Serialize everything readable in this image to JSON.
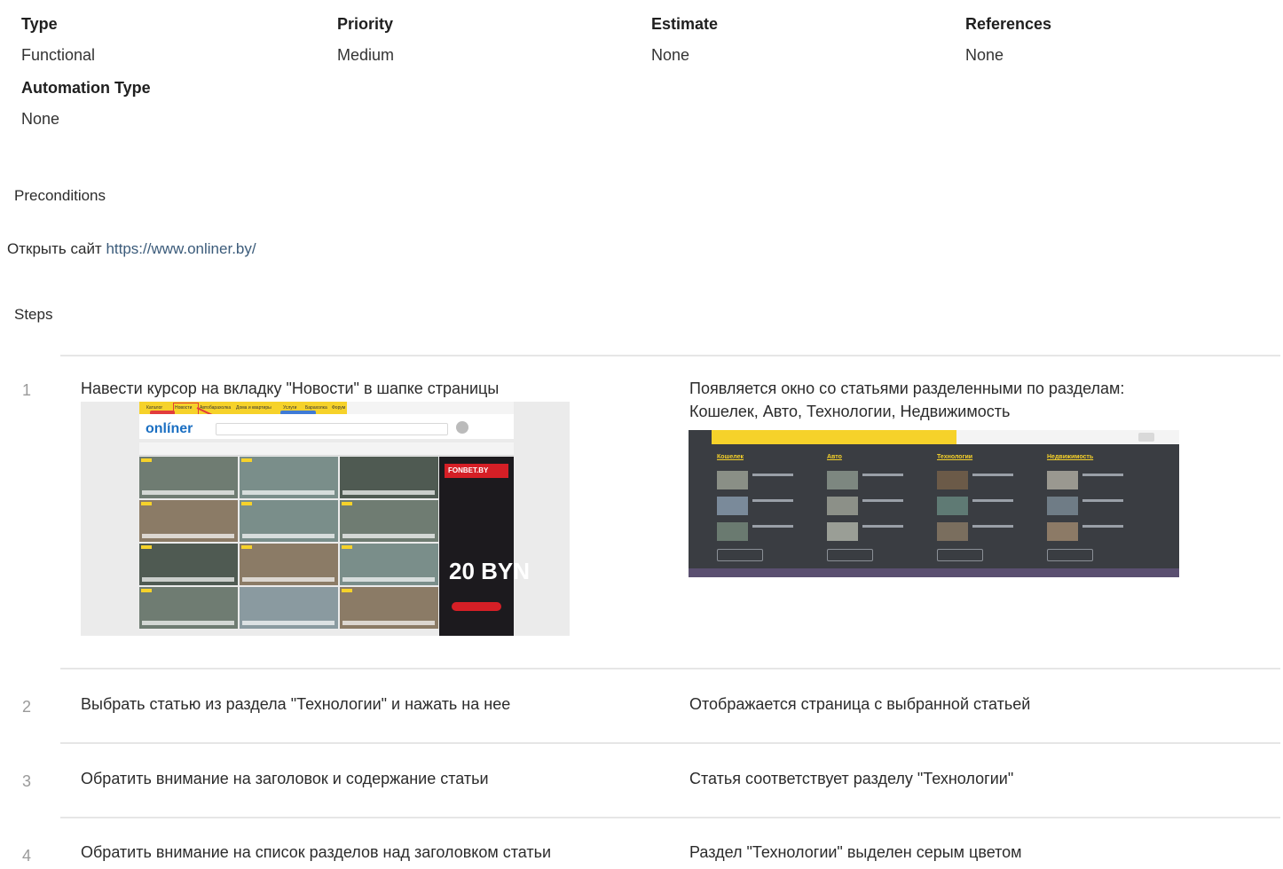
{
  "meta": {
    "type_label": "Type",
    "type_value": "Functional",
    "priority_label": "Priority",
    "priority_value": "Medium",
    "estimate_label": "Estimate",
    "estimate_value": "None",
    "references_label": "References",
    "references_value": "None",
    "automation_label": "Automation Type",
    "automation_value": "None"
  },
  "preconditions": {
    "title": "Preconditions",
    "text_prefix": "Открыть сайт ",
    "link": "https://www.onliner.by/"
  },
  "steps": {
    "title": "Steps",
    "items": [
      {
        "num": "1",
        "action": "Навести курсор на вкладку \"Новости\" в шапке страницы",
        "expected_line1": "Появляется окно со статьями разделенными по разделам:",
        "expected_line2": "Кошелек, Авто, Технологии, Недвижимость"
      },
      {
        "num": "2",
        "action": "Выбрать статью из раздела \"Технологии\" и нажать на нее",
        "expected": "Отображается страница с выбранной статьей"
      },
      {
        "num": "3",
        "action": "Обратить внимание на заголовок и содержание статьи",
        "expected": "Статья соответствует разделу \"Технологии\""
      },
      {
        "num": "4",
        "action": "Обратить внимание на список разделов над заголовком статьи",
        "expected": "Раздел \"Технологии\" выделен серым цветом"
      }
    ]
  },
  "screenshot1": {
    "nav": [
      "Каталог",
      "Новости",
      "Автобарахолка",
      "Дома и квартиры",
      "Услуги",
      "Барахолка",
      "Форум"
    ],
    "logo": "onlíner",
    "ad_brand": "FONBET.BY",
    "ad_amount": "20 BYN"
  },
  "screenshot2": {
    "columns": [
      "Кошелек",
      "Авто",
      "Технологии",
      "Недвижимость"
    ]
  },
  "colors": {
    "accent_yellow": "#f6d22a",
    "link": "#3b5b7a",
    "highlight_red": "#e23c3c",
    "dark_panel": "#3a3d42"
  }
}
